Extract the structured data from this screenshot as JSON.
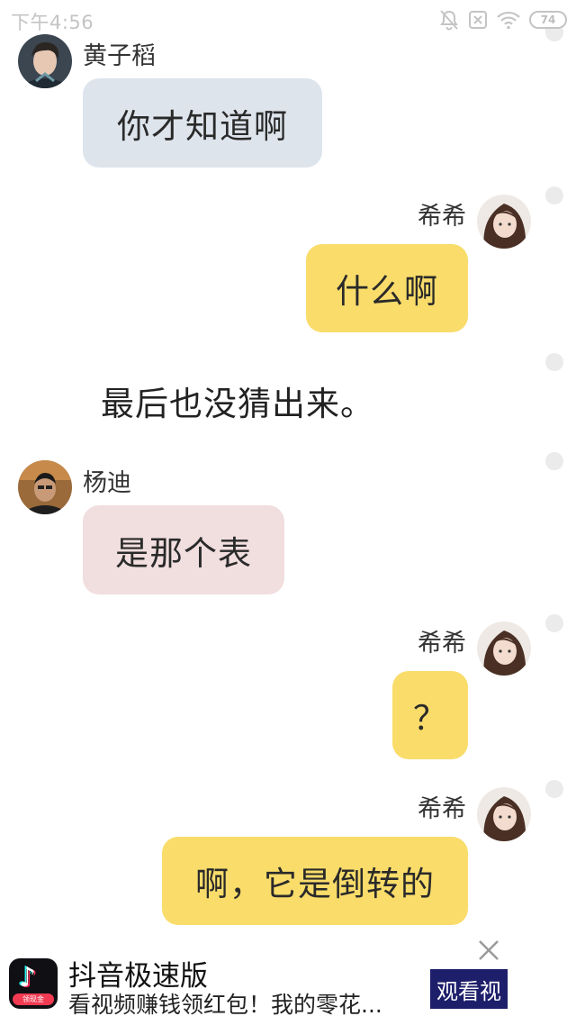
{
  "status_bar": {
    "time": "下午4:56",
    "battery": "74",
    "icons": [
      "notification-muted-icon",
      "no-sim-icon",
      "wifi-icon",
      "battery-icon"
    ]
  },
  "messages": [
    {
      "kind": "incoming",
      "sender": "黄子稻",
      "text": "你才知道啊",
      "bubble_color": "#dde4ec"
    },
    {
      "kind": "outgoing",
      "sender": "希希",
      "text": "什么啊",
      "bubble_color": "#f9dc6a"
    },
    {
      "kind": "narration",
      "text": "最后也没猜出来。"
    },
    {
      "kind": "incoming",
      "sender": "杨迪",
      "text": "是那个表",
      "bubble_color": "#f1dede"
    },
    {
      "kind": "outgoing",
      "sender": "希希",
      "text": "？",
      "bubble_color": "#f9dc6a"
    },
    {
      "kind": "outgoing",
      "sender": "希希",
      "text": "啊，它是倒转的",
      "bubble_color": "#f9dc6a"
    }
  ],
  "ad": {
    "app_name": "抖音极速版",
    "description": "看视频赚钱领红包！我的零花...",
    "cta": "观看视",
    "logo_badge": "领现金",
    "icons": [
      "tiktok-logo-icon",
      "close-icon"
    ]
  },
  "colors": {
    "accent_yellow": "#f9dc6a",
    "bubble_blue": "#dde4ec",
    "bubble_pink": "#f1dede",
    "ad_cta_bg": "#1d1f6b"
  }
}
